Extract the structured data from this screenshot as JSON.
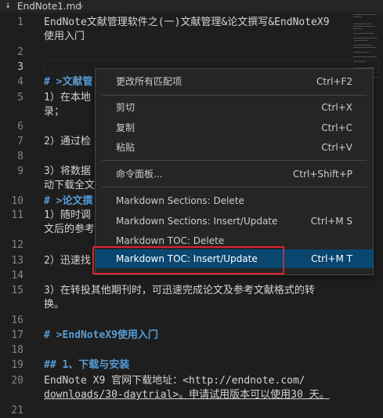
{
  "tab": {
    "filename": "EndNote1.md",
    "chevron": "›"
  },
  "lines": [
    {
      "n": "1",
      "text": "EndNote文献管理软件之(一)文献管理&论文撰写&EndNoteX9"
    },
    {
      "n": "",
      "text": "使用入门"
    },
    {
      "n": "2",
      "text": ""
    },
    {
      "n": "3",
      "text": ""
    },
    {
      "n": "4",
      "text": "# >文献管"
    },
    {
      "n": "5",
      "text": "1）在本地"
    },
    {
      "n": "",
      "text": "录；"
    },
    {
      "n": "6",
      "text": ""
    },
    {
      "n": "7",
      "text": "2）通过检"
    },
    {
      "n": "8",
      "text": ""
    },
    {
      "n": "9",
      "text": "3）将数据"
    },
    {
      "n": "",
      "text": "动下载全文"
    },
    {
      "n": "10",
      "text": "# >论文撰"
    },
    {
      "n": "11",
      "text": "1）随时调"
    },
    {
      "n": "",
      "text": "文后的参考"
    },
    {
      "n": "12",
      "text": ""
    },
    {
      "n": "13",
      "text": "2）迅速找"
    },
    {
      "n": "14",
      "text": ""
    },
    {
      "n": "15",
      "text": "3）在转投其他期刊时，可迅速完成论文及参考文献格式的转"
    },
    {
      "n": "",
      "text": "换。"
    },
    {
      "n": "16",
      "text": ""
    },
    {
      "n": "17",
      "text": "# >EndNoteX9使用入门"
    },
    {
      "n": "18",
      "text": ""
    },
    {
      "n": "19",
      "text": "## 1、下载与安装"
    },
    {
      "n": "20",
      "text": "EndNote X9 官网下载地址：<http://endnote.com/"
    },
    {
      "n": "",
      "text": "downloads/30-daytrial>。申请试用版本可以使用30 天。"
    },
    {
      "n": "21",
      "text": ""
    }
  ],
  "menu": [
    {
      "label": "更改所有匹配项",
      "key": "Ctrl+F2"
    },
    {
      "label": "剪切",
      "key": "Ctrl+X"
    },
    {
      "label": "复制",
      "key": "Ctrl+C"
    },
    {
      "label": "粘贴",
      "key": "Ctrl+V"
    },
    {
      "label": "命令面板...",
      "key": "Ctrl+Shift+P"
    },
    {
      "label": "Markdown Sections: Delete",
      "key": ""
    },
    {
      "label": "Markdown Sections: Insert/Update",
      "key": "Ctrl+M S"
    },
    {
      "label": "Markdown TOC: Delete",
      "key": ""
    },
    {
      "label": "Markdown TOC: Insert/Update",
      "key": "Ctrl+M T"
    }
  ],
  "colors": {
    "selection": "#094771",
    "highlight": "#e0202e",
    "heading": "#569cd6"
  }
}
